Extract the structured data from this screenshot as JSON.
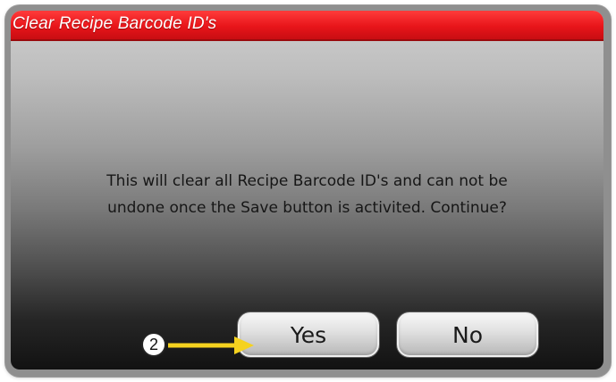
{
  "dialog": {
    "title": "Clear Recipe Barcode ID's",
    "message_line1": "This will clear all Recipe Barcode ID's and can not be",
    "message_line2": "undone once the Save button is activited. Continue?",
    "yes_label": "Yes",
    "no_label": "No"
  },
  "annotation": {
    "step_number": "2",
    "arrow_icon": "arrow-right-icon",
    "arrow_color": "#f5d21f"
  },
  "colors": {
    "titlebar": "#e8151a",
    "title_text": "#ffffff"
  }
}
